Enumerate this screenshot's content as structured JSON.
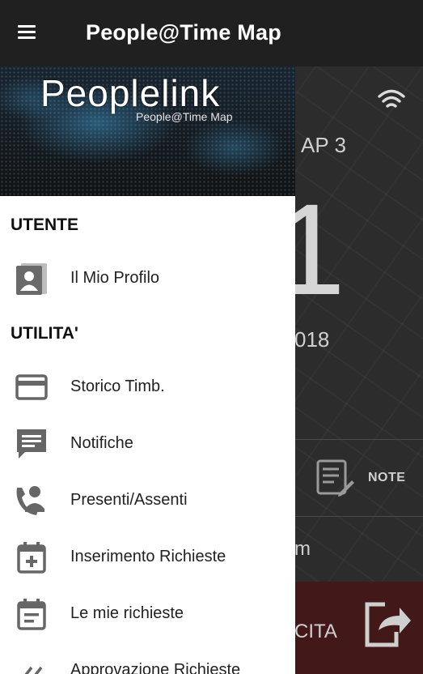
{
  "appbar": {
    "title": "People@Time Map"
  },
  "drawer": {
    "logo_text": "Peoplelink",
    "logo_subtitle": "People@Time Map",
    "sections": [
      {
        "title": "UTENTE"
      },
      {
        "title": "UTILITA'"
      }
    ],
    "items": [
      {
        "label": "Il Mio Profilo",
        "icon": "profile-icon"
      },
      {
        "label": "Storico Timb.",
        "icon": "card-icon"
      },
      {
        "label": "Notifiche",
        "icon": "comment-icon"
      },
      {
        "label": "Presenti/Assenti",
        "icon": "person-phone-icon"
      },
      {
        "label": "Inserimento Richieste",
        "icon": "calendar-plus-icon"
      },
      {
        "label": "Le mie richieste",
        "icon": "calendar-list-icon"
      },
      {
        "label": "Approvazione Richieste",
        "icon": "double-check-icon"
      }
    ]
  },
  "background": {
    "station_partial": "AP 3",
    "big_digit": "1",
    "date_partial": "018",
    "note_label": "NOTE",
    "m_partial": "m",
    "exit_partial": "CITA"
  },
  "colors": {
    "appbar": "#202020",
    "drawer": "#ffffff",
    "icon_gray": "#666666",
    "exit_bar": "#431818"
  }
}
